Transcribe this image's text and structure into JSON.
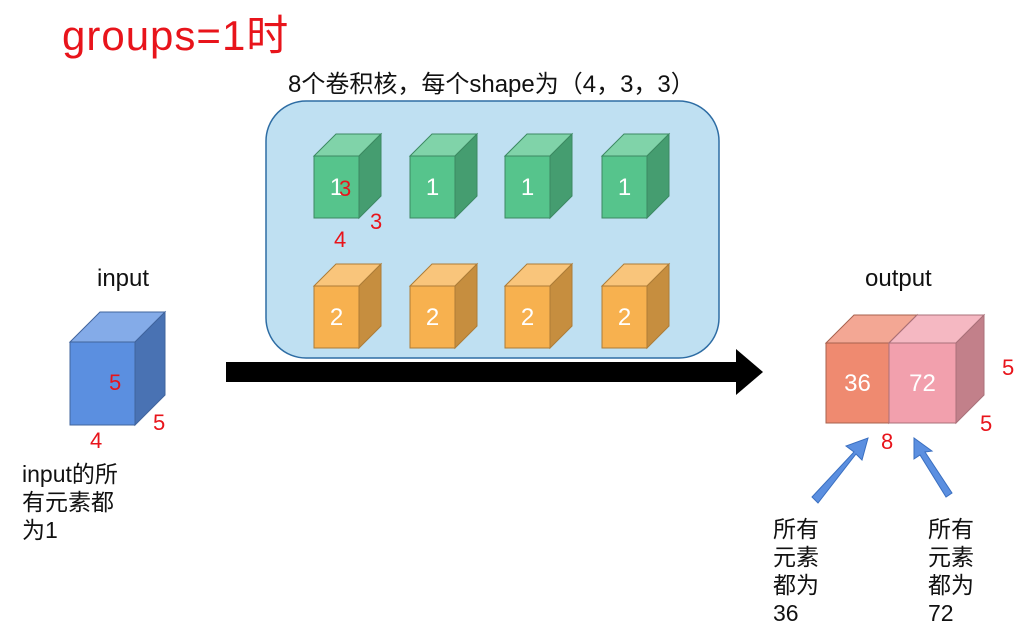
{
  "title": "groups=1时",
  "kernel_caption": "8个卷积核，每个shape为（4，3，3）",
  "input": {
    "label": "input",
    "depth": "5",
    "width": "4",
    "side": "5",
    "note": "input的所\n有元素都\n为1",
    "color": "#5b8fe0"
  },
  "kernels": {
    "row1_values": [
      "1",
      "1",
      "1",
      "1"
    ],
    "row2_values": [
      "2",
      "2",
      "2",
      "2"
    ],
    "row1_color": "#56c48c",
    "row2_color": "#f7b14f",
    "dim_overlay": "3",
    "dim_width": "4",
    "dim_side": "3",
    "panel_color": "#bfe0f2"
  },
  "output": {
    "label": "output",
    "left_value": "36",
    "right_value": "72",
    "dim_top_right": "5",
    "dim_side": "5",
    "dim_bottom": "8",
    "left_color": "#ef8a70",
    "right_color": "#f2a0ad",
    "note_left": "所有\n元素\n都为\n36",
    "note_right": "所有\n元素\n都为\n72"
  }
}
